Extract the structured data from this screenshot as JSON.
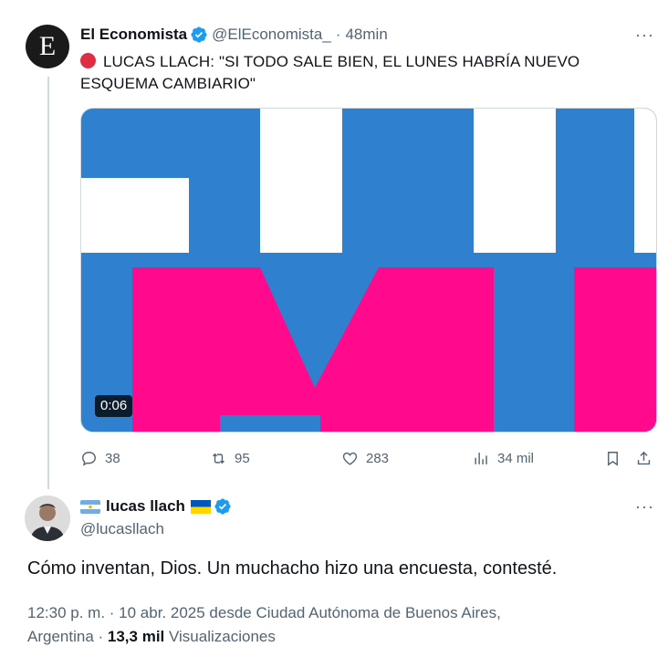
{
  "tweet1": {
    "avatar_letter": "E",
    "name": "El Economista",
    "handle": "@ElEconomista_",
    "separator": "·",
    "time": "48min",
    "more": "···",
    "text": "LUCAS LLACH: \"SI TODO SALE BIEN, EL LUNES HABRÍA NUEVO ESQUEMA CAMBIARIO\"",
    "video_duration": "0:06",
    "actions": {
      "replies": "38",
      "retweets": "95",
      "likes": "283",
      "views": "34 mil"
    },
    "colors": {
      "media_blue": "#2f80cf",
      "media_pink": "#ff0a8c",
      "media_white": "#ffffff"
    }
  },
  "tweet2": {
    "name": "lucas llach",
    "handle": "@lucasllach",
    "more": "···",
    "text": "Cómo inventan, Dios. Un muchacho hizo una encuesta, contesté.",
    "meta_line1": "12:30 p. m. · 10 abr. 2025 desde Ciudad Autónoma de Buenos Aires,",
    "meta_place": "Argentina",
    "meta_sep": " · ",
    "views_count": "13,3 mil",
    "views_label": " Visualizaciones"
  },
  "icons": [
    "verified-badge-icon",
    "red-circle-icon",
    "reply-icon",
    "retweet-icon",
    "like-icon",
    "views-icon",
    "bookmark-icon",
    "share-icon",
    "argentina-flag-icon",
    "ukraine-flag-icon"
  ]
}
